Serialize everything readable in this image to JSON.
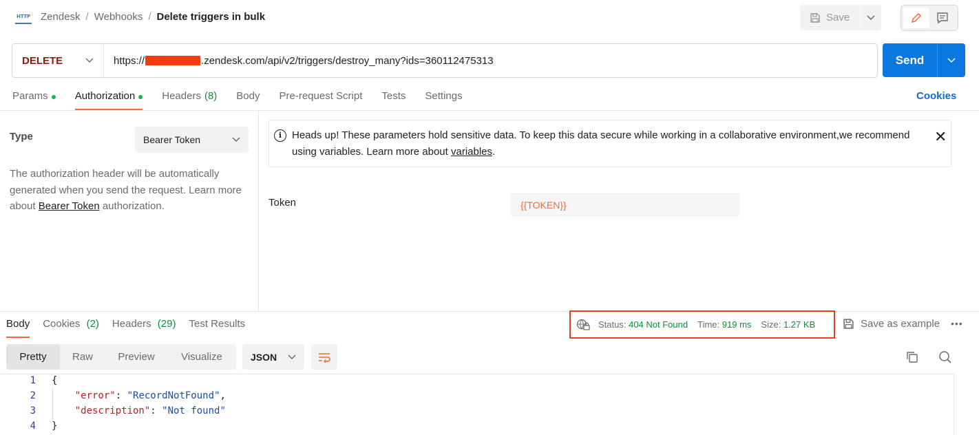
{
  "header": {
    "http_badge": "HTTP",
    "breadcrumb": [
      "Zendesk",
      "Webhooks",
      "Delete triggers in bulk"
    ],
    "breadcrumb_sep": "/",
    "save_label": "Save"
  },
  "request": {
    "method": "DELETE",
    "url_prefix": "https://",
    "url_suffix": ".zendesk.com/api/v2/triggers/destroy_many?ids=360112475313",
    "send_label": "Send"
  },
  "req_tabs": [
    {
      "label": "Params",
      "dot": true
    },
    {
      "label": "Authorization",
      "dot": true
    },
    {
      "label": "Headers",
      "count": "(8)"
    },
    {
      "label": "Body"
    },
    {
      "label": "Pre-request Script"
    },
    {
      "label": "Tests"
    },
    {
      "label": "Settings"
    }
  ],
  "cookies_link": "Cookies",
  "auth": {
    "type_label": "Type",
    "type_value": "Bearer Token",
    "desc_before": "The authorization header will be automatically generated when you send the request. Learn more about ",
    "desc_link": "Bearer Token",
    "desc_after": " authorization.",
    "notice_text": "Heads up! These parameters hold sensitive data. To keep this data secure while working in a collaborative environment,we recommend using variables. Learn more about ",
    "notice_link": "variables",
    "notice_end": ".",
    "token_label": "Token",
    "token_value": "{{TOKEN}}"
  },
  "response": {
    "tabs": [
      {
        "label": "Body"
      },
      {
        "label": "Cookies",
        "count": "(2)"
      },
      {
        "label": "Headers",
        "count": "(29)"
      },
      {
        "label": "Test Results"
      }
    ],
    "status_label": "Status:",
    "status_value": "404 Not Found",
    "time_label": "Time:",
    "time_value": "919 ms",
    "size_label": "Size:",
    "size_value": "1.27 KB",
    "save_example": "Save as example",
    "more": "•••",
    "view_tabs": [
      "Pretty",
      "Raw",
      "Preview",
      "Visualize"
    ],
    "format": "JSON",
    "code_lines": [
      {
        "n": "1",
        "text": "{"
      },
      {
        "n": "2",
        "key": "\"error\"",
        "val": "\"RecordNotFound\"",
        "tail": ","
      },
      {
        "n": "3",
        "key": "\"description\"",
        "val": "\"Not found\"",
        "tail": ""
      },
      {
        "n": "4",
        "text": "}"
      }
    ]
  },
  "colors": {
    "accent": "#f26b3a",
    "send": "#0d77e0",
    "method": "#8e1a10",
    "status_ok": "#0c8f3d",
    "highlight_box": "#e0421a"
  }
}
